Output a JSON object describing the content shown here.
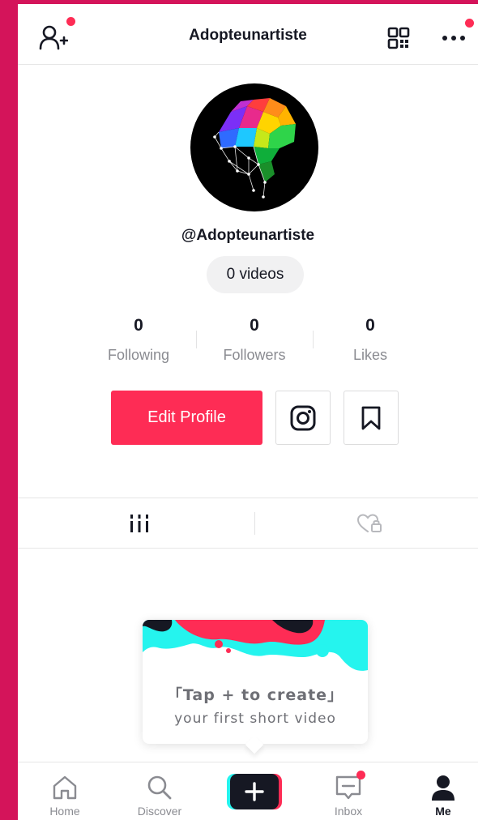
{
  "header": {
    "title": "Adopteunartiste",
    "icons": [
      "add-friend-icon",
      "qr-code-icon",
      "more-icon"
    ]
  },
  "profile": {
    "handle": "@Adopteunartiste",
    "videos_label": "0 videos"
  },
  "stats": [
    {
      "value": "0",
      "label": "Following"
    },
    {
      "value": "0",
      "label": "Followers"
    },
    {
      "value": "0",
      "label": "Likes"
    }
  ],
  "actions": {
    "edit_profile": "Edit Profile",
    "icons": [
      "instagram-icon",
      "bookmark-icon"
    ]
  },
  "tabs": {
    "icons": [
      "videos-grid-icon",
      "liked-lock-icon"
    ]
  },
  "create_card": {
    "line1": "「Tap + to create」",
    "line2": "your first short video"
  },
  "bottom_nav": [
    {
      "label": "Home",
      "icon": "home-icon"
    },
    {
      "label": "Discover",
      "icon": "search-icon"
    },
    {
      "label": "",
      "icon": "create-plus-icon"
    },
    {
      "label": "Inbox",
      "icon": "inbox-icon"
    },
    {
      "label": "Me",
      "icon": "profile-icon"
    }
  ],
  "colors": {
    "accent": "#fe2c55",
    "cyan": "#25f4ee",
    "background_frame": "#d4145a",
    "text": "#161823",
    "muted": "#8a8b91"
  }
}
